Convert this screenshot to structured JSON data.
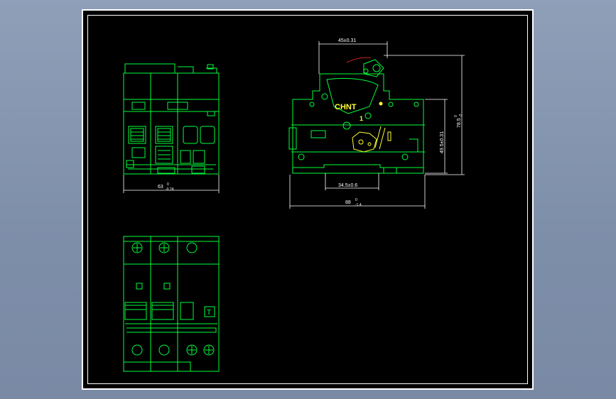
{
  "drawing": {
    "front_view": {
      "width_dim": "63",
      "width_tol_upper": "0",
      "width_tol_lower": "-0.74"
    },
    "side_view": {
      "top_dim": "45±0.31",
      "rail_dim": "34.5±0.6",
      "depth_dim": "88",
      "depth_tol_upper": "0",
      "depth_tol_lower": "-1.4",
      "height_dim": "49.5±0.31",
      "overall_height_dim": "78.5",
      "overall_height_tol_upper": "0",
      "overall_height_tol_lower": "-2",
      "brand": "CHNT",
      "mark_on": "1"
    },
    "bottom_view": {
      "test_button_label": "T"
    }
  },
  "colors": {
    "background": "#000000",
    "outline": "#00ff3c",
    "dimension": "#ffffff",
    "accent": "#ffff33",
    "viewport_bg": "#8f9fb8"
  }
}
